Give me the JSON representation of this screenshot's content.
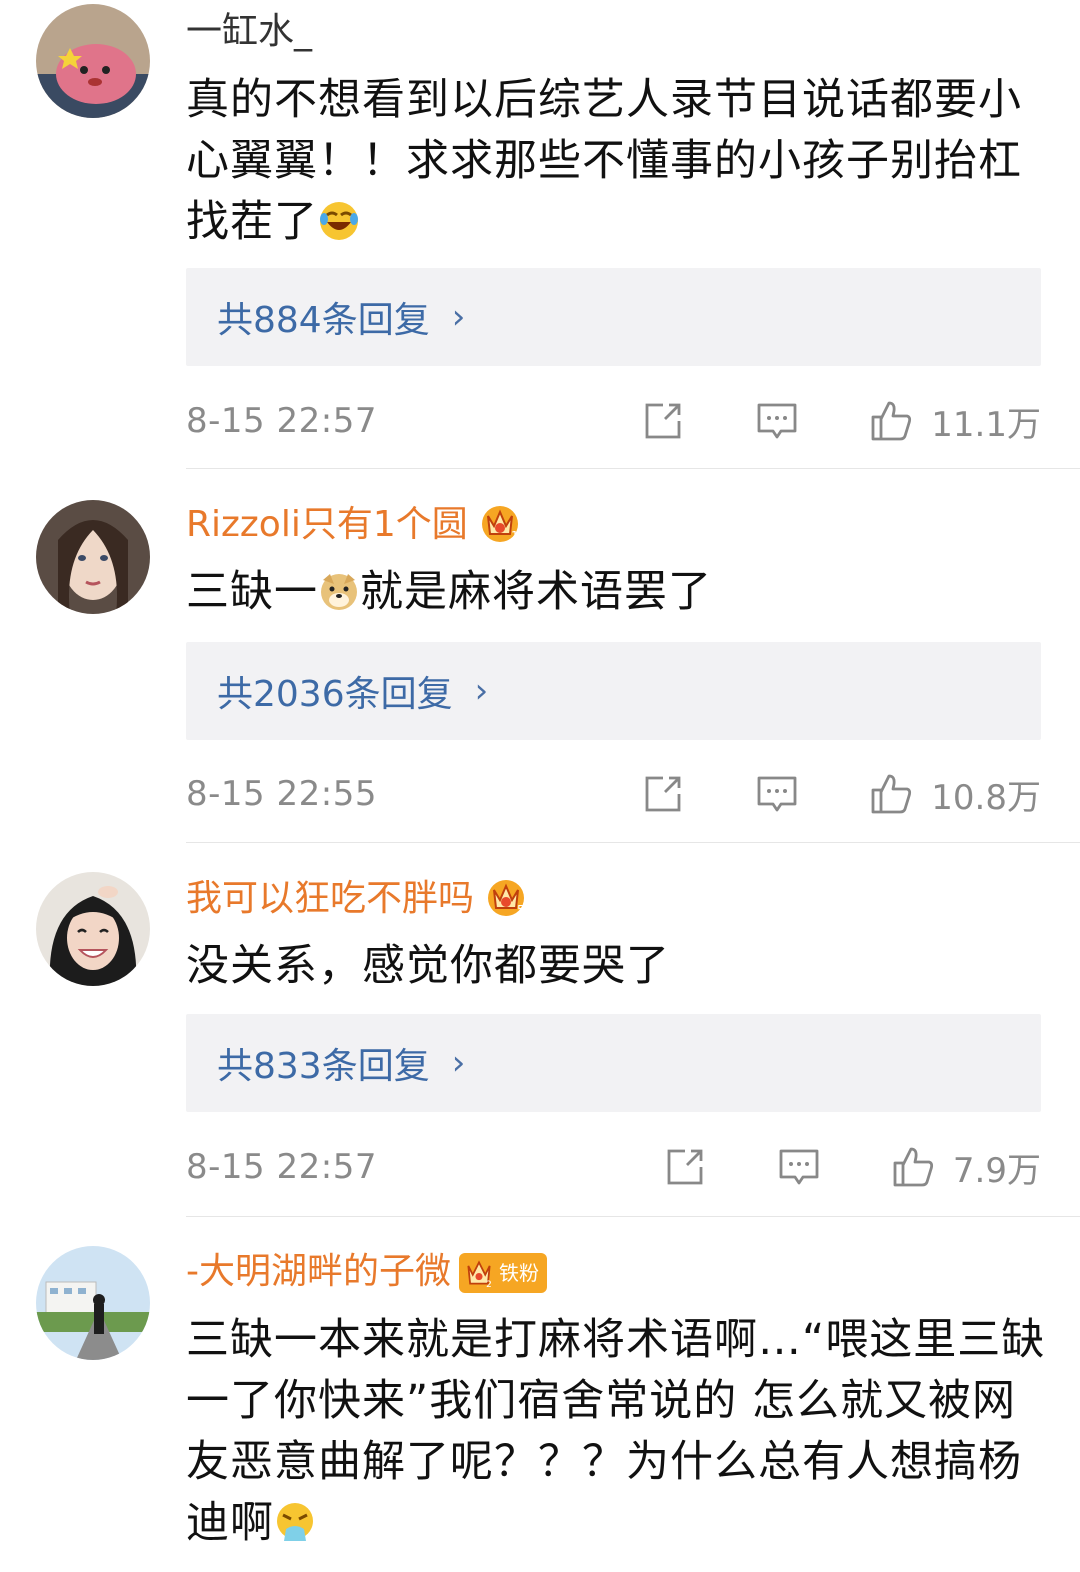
{
  "comments": [
    {
      "username": "一缸水_",
      "text": "真的不想看到以后综艺人录节目说话都要小心翼翼！！求求那些不懂事的小孩子别抬杠找茬了",
      "emoji": "laughing-crying-emoji",
      "replies": "共884条回复",
      "time": "8-15 22:57",
      "likes": "11.1万"
    },
    {
      "username": "Rizzoli只有1个圆",
      "badge": "vip-crown-1",
      "text_before": "三缺一",
      "emoji": "doge-emoji",
      "text_after": "就是麻将术语罢了",
      "replies": "共2036条回复",
      "time": "8-15 22:55",
      "likes": "10.8万"
    },
    {
      "username": "我可以狂吃不胖吗",
      "badge": "vip-crown-5",
      "text": "没关系，感觉你都要哭了",
      "replies": "共833条回复",
      "time": "8-15 22:57",
      "likes": "7.9万"
    },
    {
      "username": "-大明湖畔的子微",
      "badge": "vip-crown-2",
      "fan_badge": "铁粉",
      "text": "三缺一本来就是打麻将术语啊…“喂这里三缺一了你快来”我们宿舍常说的 怎么就又被网友恶意曲解了呢？？？为什么总有人想搞杨迪啊",
      "emoji": "vomit-emoji"
    }
  ],
  "colors": {
    "vip_name": "#e8792b",
    "reply_link": "#3d6aa6",
    "reply_bg": "#f2f2f4",
    "meta_gray": "#8a8a8a"
  }
}
